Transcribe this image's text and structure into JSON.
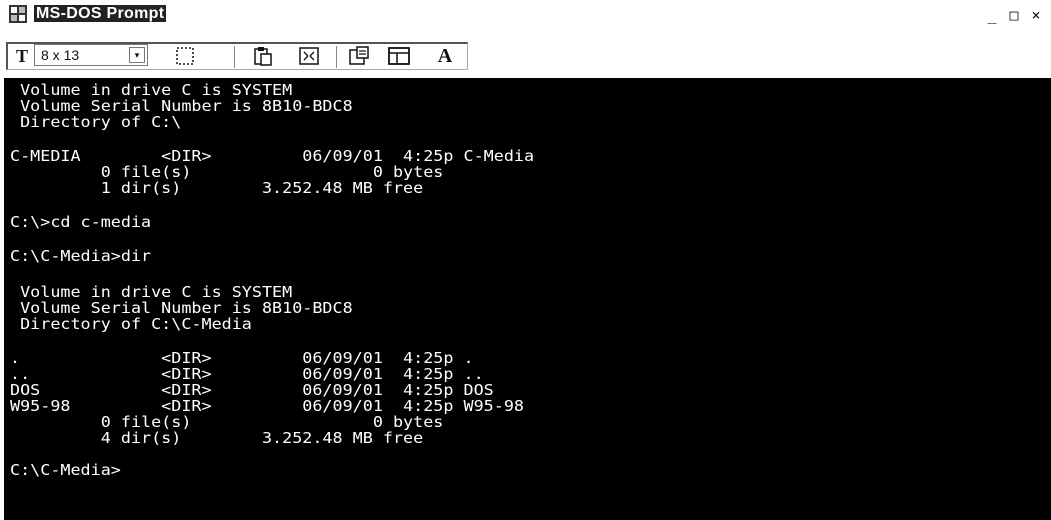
{
  "window": {
    "title": "MS-DOS Prompt",
    "buttons": {
      "minimize": "_",
      "maximize": "□",
      "close": "×"
    }
  },
  "toolbar": {
    "font_icon": "T",
    "font_size": "8 x 13",
    "dropdown_arrow": "▾",
    "bold_a": "A"
  },
  "console": {
    "lines": [
      " Volume in drive C is SYSTEM",
      " Volume Serial Number is 8B10-BDC8",
      " Directory of C:\\",
      "",
      "C-MEDIA        <DIR>         06/09/01  4:25p C-Media",
      "         0 file(s)                  0 bytes",
      "         1 dir(s)        3.252.48 MB free",
      "",
      "C:\\>cd c-media",
      "",
      "C:\\C-Media>dir",
      "",
      " Volume in drive C is SYSTEM",
      " Volume Serial Number is 8B10-BDC8",
      " Directory of C:\\C-Media",
      "",
      ".              <DIR>         06/09/01  4:25p .",
      "..             <DIR>         06/09/01  4:25p ..",
      "DOS            <DIR>         06/09/01  4:25p DOS",
      "W95-98         <DIR>         06/09/01  4:25p W95-98",
      "         0 file(s)                  0 bytes",
      "         4 dir(s)        3.252.48 MB free",
      "",
      "C:\\C-Media>"
    ]
  }
}
